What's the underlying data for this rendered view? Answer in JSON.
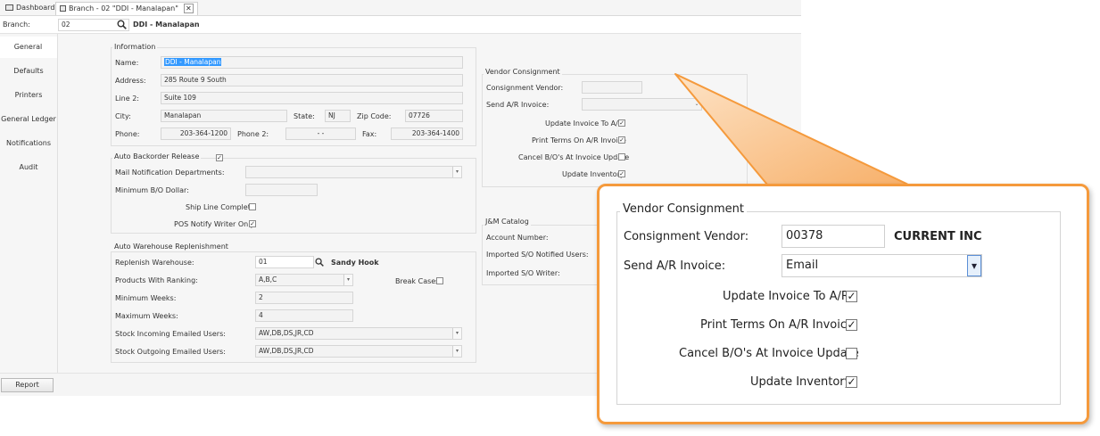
{
  "tabs": [
    {
      "label": "Dashboard"
    },
    {
      "label": "Branch - 02 \"DDI - Manalapan\""
    }
  ],
  "branch_bar": {
    "label": "Branch:",
    "value": "02",
    "name": "DDI - Manalapan"
  },
  "nav": [
    "General",
    "Defaults",
    "Printers",
    "General Ledger",
    "Notifications",
    "Audit"
  ],
  "information": {
    "title": "Information",
    "name_label": "Name:",
    "name": "DDI - Manalapan",
    "address_label": "Address:",
    "address": "285 Route 9 South",
    "line2_label": "Line 2:",
    "line2": "Suite 109",
    "city_label": "City:",
    "city": "Manalapan",
    "state_label": "State:",
    "state": "NJ",
    "zip_label": "Zip Code:",
    "zip": "07726",
    "phone_label": "Phone:",
    "phone": "203-364-1200",
    "phone2_label": "Phone 2:",
    "phone2": "-  -",
    "fax_label": "Fax:",
    "fax": "203-364-1400"
  },
  "backorder": {
    "title": "Auto Backorder Release",
    "mail_label": "Mail Notification Departments:",
    "min_label": "Minimum B/O Dollar:",
    "ship_label": "Ship Line Complete",
    "pos_label": "POS Notify Writer Only"
  },
  "replenish": {
    "title": "Auto Warehouse Replenishment",
    "warehouse_label": "Replenish Warehouse:",
    "warehouse": "01",
    "warehouse_name": "Sandy Hook",
    "ranking_label": "Products With Ranking:",
    "ranking": "A,B,C",
    "break_label": "Break Cases",
    "minweeks_label": "Minimum Weeks:",
    "minweeks": "2",
    "maxweeks_label": "Maximum Weeks:",
    "maxweeks": "4",
    "incoming_label": "Stock Incoming Emailed Users:",
    "incoming": "AW,DB,DS,JR,CD",
    "outgoing_label": "Stock Outgoing Emailed Users:",
    "outgoing": "AW,DB,DS,JR,CD"
  },
  "vendor": {
    "title": "Vendor Consignment",
    "vendor_label": "Consignment Vendor:",
    "send_label": "Send A/R Invoice:",
    "update_label": "Update Invoice To A/R",
    "print_label": "Print Terms On A/R Invoice",
    "cancel_label": "Cancel B/O's At Invoice Update",
    "inventory_label": "Update Inventory"
  },
  "jm": {
    "title": "J&M Catalog",
    "account_label": "Account Number:",
    "notified_label": "Imported S/O Notified Users:",
    "writer_label": "Imported S/O Writer:"
  },
  "footer": {
    "report": "Report"
  },
  "zoom": {
    "title": "Vendor Consignment",
    "vendor_label": "Consignment Vendor:",
    "vendor_value": "00378",
    "vendor_name": "CURRENT INC",
    "send_label": "Send A/R Invoice:",
    "send_value": "Email",
    "update_label": "Update Invoice To A/R",
    "print_label": "Print Terms On A/R Invoice",
    "cancel_label": "Cancel B/O's At Invoice Update",
    "inventory_label": "Update Inventory"
  },
  "colors": {
    "accent": "#f59a3c",
    "selection": "#3399ff"
  }
}
